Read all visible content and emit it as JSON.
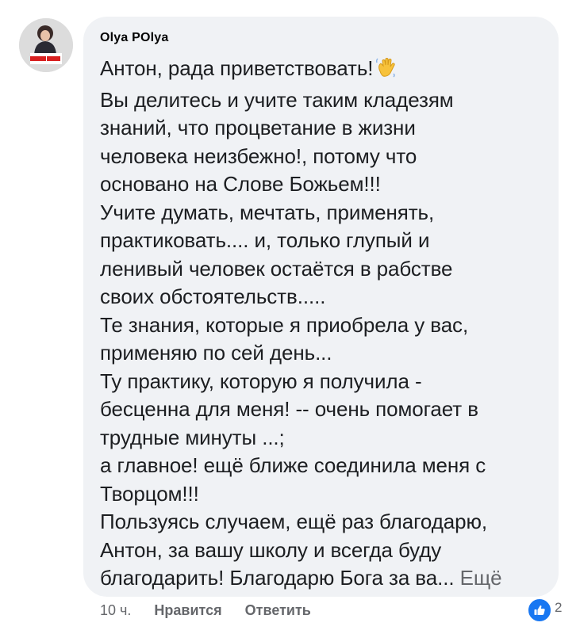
{
  "comment": {
    "author": "Olya POlya",
    "lines": [
      "Антон, рада приветствовать!",
      "Вы делитесь и учите таким кладезям",
      "знаний, что процветание в жизни",
      "человека неизбежно!, потому что",
      "основано на Слове Божьем!!!",
      "Учите думать, мечтать, применять,",
      "практиковать.... и,  только глупый и",
      "ленивый человек остаётся в рабстве",
      "своих обстоятельств.....",
      "Те знания, которые я приобрела у вас,",
      "применяю по сей день...",
      "Ту практику, которую я получила -",
      "бесценна для меня! -- очень помогает в",
      "трудные минуты ...;",
      "а главное! ещё ближе соединила меня с",
      "Творцом!!!",
      "Пользуясь случаем, ещё раз благодарю,",
      "Антон, за вашу школу и всегда буду",
      "благодарить! Благодарю Бога за ва..."
    ],
    "emoji": "waving-hand",
    "see_more": "Ещё",
    "time": "10 ч.",
    "like_label": "Нравится",
    "reply_label": "Ответить",
    "reaction_count": "2",
    "reaction_icon": "thumbs-up-icon"
  },
  "colors": {
    "bubble": "#f0f2f5",
    "text": "#1c1e21",
    "secondary": "#65676b",
    "like_blue": "#1877f2"
  }
}
